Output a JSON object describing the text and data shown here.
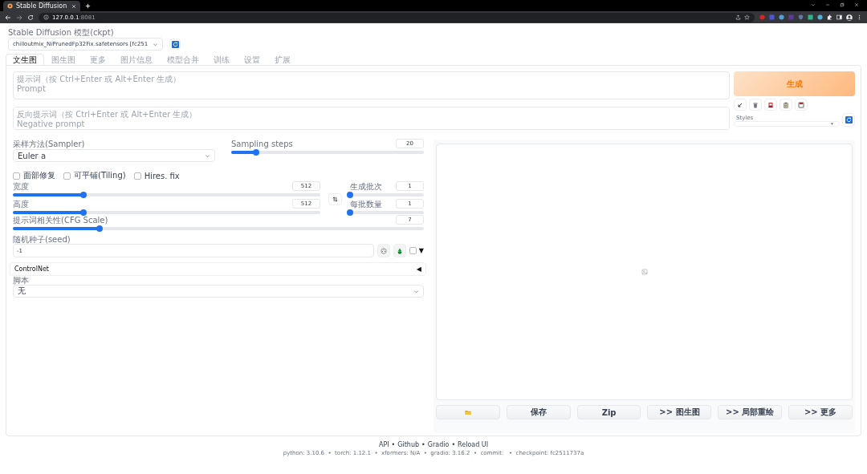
{
  "browser": {
    "tab_title": "Stable Diffusion",
    "url_host": "127.0.0.1",
    "url_port": ":8081"
  },
  "model": {
    "label": "Stable Diffusion 模型(ckpt)",
    "value": "chilloutmix_NiPrunedFp32Fix.safetensors [fc251"
  },
  "tabs": [
    {
      "label": "文生图",
      "selected": true
    },
    {
      "label": "图生图",
      "selected": false
    },
    {
      "label": "更多",
      "selected": false
    },
    {
      "label": "图片信息",
      "selected": false
    },
    {
      "label": "模型合并",
      "selected": false
    },
    {
      "label": "训练",
      "selected": false
    },
    {
      "label": "设置",
      "selected": false
    },
    {
      "label": "扩展",
      "selected": false
    }
  ],
  "prompt": {
    "placeholder": "提示词（按 Ctrl+Enter 或 Alt+Enter 生成）\nPrompt"
  },
  "negative_prompt": {
    "placeholder": "反向提示词（按 Ctrl+Enter 或 Alt+Enter 生成）\nNegative prompt"
  },
  "generate_button": "生成",
  "styles": {
    "label": "Styles"
  },
  "sampler": {
    "label": "采样方法(Sampler)",
    "value": "Euler a"
  },
  "sliders": [
    {
      "label": "Sampling steps",
      "value": "20",
      "level": 0.13
    },
    {
      "label": "宽度",
      "value": "512",
      "level": 0.23
    },
    {
      "label": "生成批次",
      "value": "1",
      "level": 0
    },
    {
      "label": "高度",
      "value": "512",
      "level": 0.23
    },
    {
      "label": "每批数量",
      "value": "1",
      "level": 0
    },
    {
      "label": "提示词相关性(CFG Scale)",
      "value": "7",
      "level": 0.21
    }
  ],
  "checkboxes": [
    {
      "label": "面部修复",
      "checked": false
    },
    {
      "label": "可平铺(Tiling)",
      "checked": false
    },
    {
      "label": "Hires. fix",
      "checked": false
    }
  ],
  "seed": {
    "label": "随机种子(seed)",
    "value": "-1"
  },
  "seed_extra": {
    "checked": false,
    "toggle": "▼"
  },
  "controlnet": {
    "title": "ControlNet",
    "toggle": "◀"
  },
  "script": {
    "label": "脚本",
    "value": "无"
  },
  "output_buttons": [
    "保存",
    "Zip",
    ">> 图生图",
    ">> 局部重绘",
    ">> 更多"
  ],
  "footer": {
    "links": [
      {
        "label": "API"
      },
      {
        "label": "Github",
        "separator": "•"
      },
      {
        "label": "Gradio",
        "separator": "•"
      },
      {
        "label": "Reload UI",
        "separator": "•"
      }
    ],
    "versions": "python: 3.10.6  •  torch: 1.12.1  •  xformers: N/A  •  gradio: 3.16.2  •  commit:   •  checkpoint: fc2511737a"
  }
}
